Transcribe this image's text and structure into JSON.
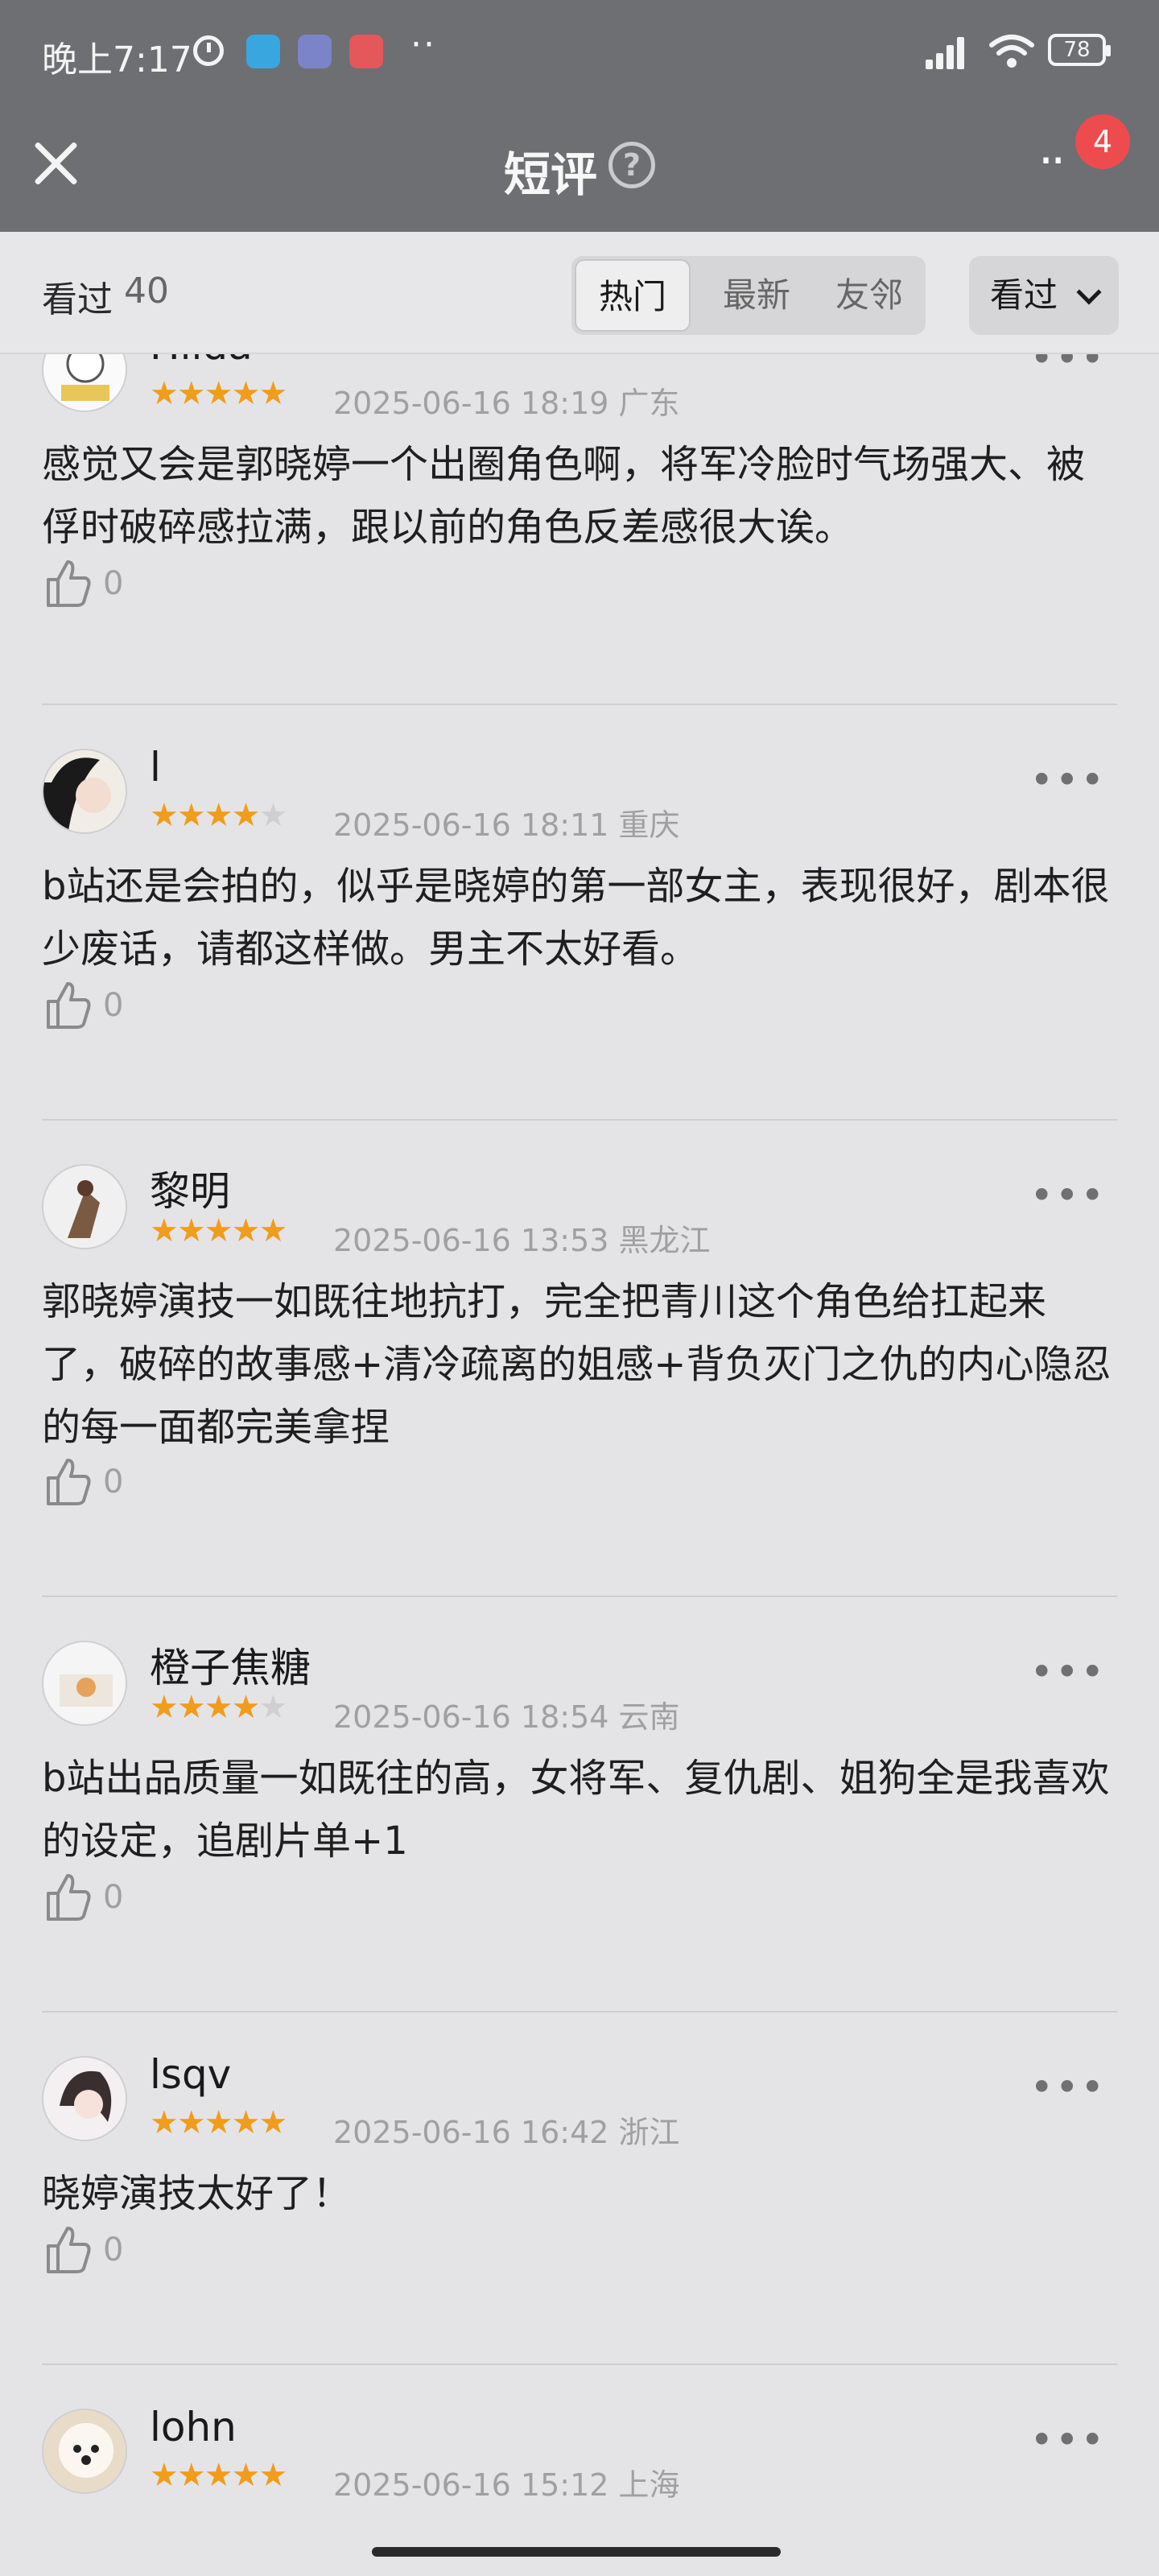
{
  "status_bar": {
    "time": "晚上7:17",
    "more": "··",
    "battery": "78",
    "icons": [
      "clock-icon",
      "app-icon-bag",
      "app-icon-bot",
      "app-icon-red",
      "signal-icon",
      "wifi-icon",
      "battery-icon"
    ]
  },
  "nav": {
    "title": "短评",
    "help": "?",
    "badge": "4",
    "more": "··"
  },
  "filter": {
    "seen_label": "看过",
    "seen_count": "40",
    "tabs": [
      "热门",
      "最新",
      "友邻"
    ],
    "active_tab": "热门",
    "dropdown_label": "看过"
  },
  "reviews": [
    {
      "username": "Hilda",
      "rating": 5,
      "time": "2025-06-16 18:19",
      "location": "广东",
      "content": "感觉又会是郭晓婷一个出圈角色啊，将军冷脸时气场强大、被俘时破碎感拉满，跟以前的角色反差感很大诶。",
      "likes": "0"
    },
    {
      "username": "l",
      "rating": 4,
      "time": "2025-06-16 18:11",
      "location": "重庆",
      "content": "b站还是会拍的，似乎是晓婷的第一部女主，表现很好，剧本很少废话，请都这样做。男主不太好看。",
      "likes": "0"
    },
    {
      "username": "黎明",
      "rating": 5,
      "time": "2025-06-16 13:53",
      "location": "黑龙江",
      "content": "郭晓婷演技一如既往地抗打，完全把青川这个角色给扛起来了，破碎的故事感+清冷疏离的姐感+背负灭门之仇的内心隐忍的每一面都完美拿捏",
      "likes": "0"
    },
    {
      "username": "橙子焦糖",
      "rating": 4,
      "time": "2025-06-16 18:54",
      "location": "云南",
      "content": "b站出品质量一如既往的高，女将军、复仇剧、姐狗全是我喜欢的设定，追剧片单+1",
      "likes": "0"
    },
    {
      "username": "lsqv",
      "rating": 5,
      "time": "2025-06-16 16:42",
      "location": "浙江",
      "content": "晓婷演技太好了！",
      "likes": "0"
    },
    {
      "username": "lohn",
      "rating": 5,
      "time": "2025-06-16 15:12",
      "location": "上海",
      "content": "",
      "likes": ""
    }
  ],
  "colors": {
    "star_on": "#f19c1a",
    "star_off": "#cfcfd1",
    "header_bg": "#6d6f73",
    "badge": "#ee4b4f"
  }
}
